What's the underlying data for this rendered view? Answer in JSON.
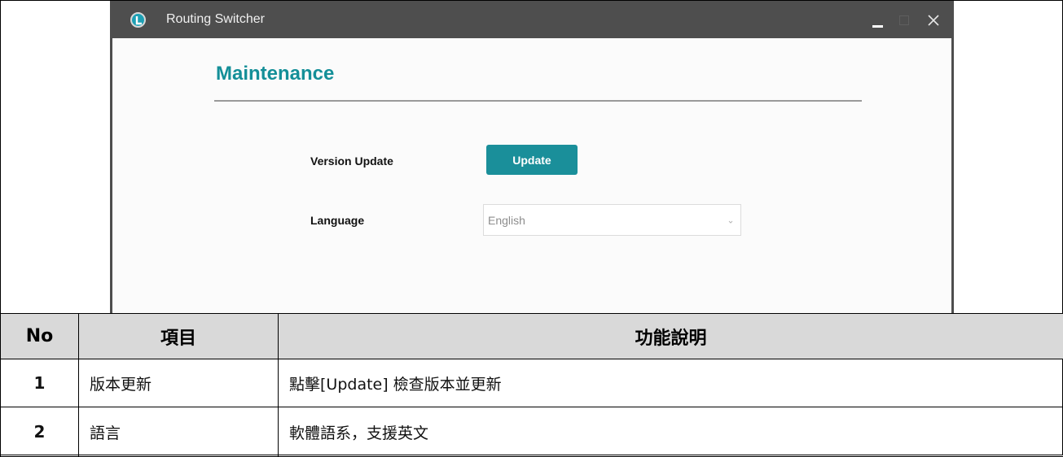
{
  "app": {
    "title": "Routing Switcher",
    "icon": "app-logo-icon",
    "accent_color": "#148f98",
    "titlebar_color": "#4e4e4e",
    "controls": {
      "minimize": "minimize-icon",
      "maximize": "maximize-icon",
      "close": "close-icon"
    }
  },
  "page": {
    "title": "Maintenance",
    "version_update": {
      "label": "Version Update",
      "button_label": "Update"
    },
    "language": {
      "label": "Language",
      "selected": "English"
    }
  },
  "table": {
    "headers": [
      "No",
      "項目",
      "功能說明"
    ],
    "rows": [
      {
        "no": "1",
        "item": "版本更新",
        "desc": "點擊[Update]  檢查版本並更新"
      },
      {
        "no": "2",
        "item": "語言",
        "desc": "軟體語系，支援英文"
      }
    ]
  }
}
